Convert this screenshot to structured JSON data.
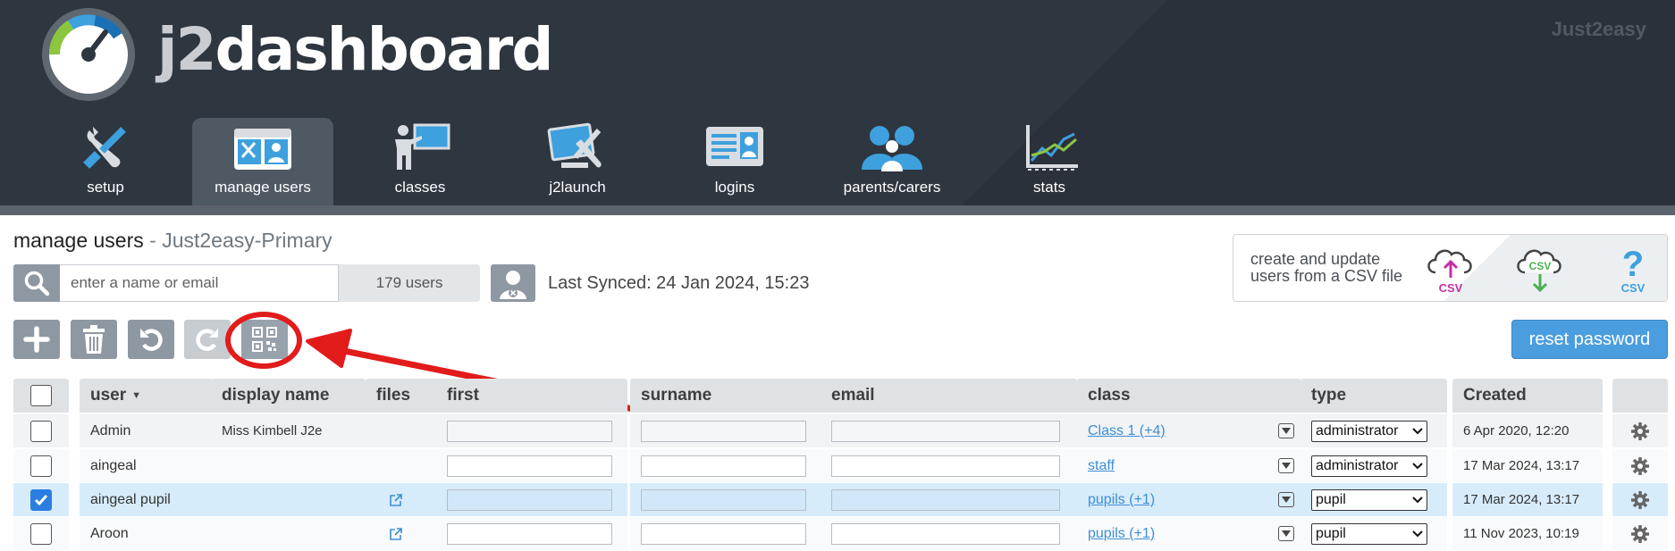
{
  "app": {
    "logo_prefix": "j2",
    "logo_suffix": "dashboard",
    "brand": "Just2easy"
  },
  "nav": [
    {
      "label": "setup",
      "icon": "tools-icon"
    },
    {
      "label": "manage users",
      "icon": "manage-users-icon",
      "active": true
    },
    {
      "label": "classes",
      "icon": "classes-icon"
    },
    {
      "label": "j2launch",
      "icon": "j2launch-icon"
    },
    {
      "label": "logins",
      "icon": "logins-icon"
    },
    {
      "label": "parents/carers",
      "icon": "parents-icon"
    },
    {
      "label": "stats",
      "icon": "stats-icon"
    }
  ],
  "page": {
    "title": "manage users",
    "separator": " - ",
    "school": "Just2easy-Primary"
  },
  "search": {
    "placeholder": "enter a name or email",
    "value": "",
    "count": "179 users"
  },
  "sync": {
    "text": "Last Synced: 24 Jan 2024, 15:23"
  },
  "csv": {
    "line1": "create and update",
    "line2": "users from a CSV file",
    "upload_label": "CSV",
    "download_label": "CSV",
    "help_label": "CSV"
  },
  "toolbar": {
    "reset_password": "reset password"
  },
  "table": {
    "headers": {
      "user": "user",
      "display_name": "display name",
      "files": "files",
      "first": "first",
      "surname": "surname",
      "email": "email",
      "class": "class",
      "type": "type",
      "created": "Created"
    },
    "rows": [
      {
        "user": "Admin",
        "display_name": "Miss Kimbell J2e",
        "files": false,
        "class": "Class 1 (+4)",
        "type": "administrator",
        "created": "6 Apr 2020, 12:20",
        "checked": false
      },
      {
        "user": "aingeal",
        "display_name": "",
        "files": false,
        "class": "staff",
        "type": "administrator",
        "created": "17 Mar 2024, 13:17",
        "checked": false
      },
      {
        "user": "aingeal pupil",
        "display_name": "",
        "files": true,
        "class": "pupils (+1)",
        "type": "pupil",
        "created": "17 Mar 2024, 13:17",
        "checked": true
      },
      {
        "user": "Aroon",
        "display_name": "",
        "files": true,
        "class": "pupils (+1)",
        "type": "pupil",
        "created": "11 Nov 2023, 10:19",
        "checked": false
      }
    ]
  },
  "colors": {
    "header_bg": "#2e3640",
    "accent_blue": "#4a9ee0",
    "highlight_red": "#e21b1b",
    "selected_row": "#d7ecfb"
  }
}
